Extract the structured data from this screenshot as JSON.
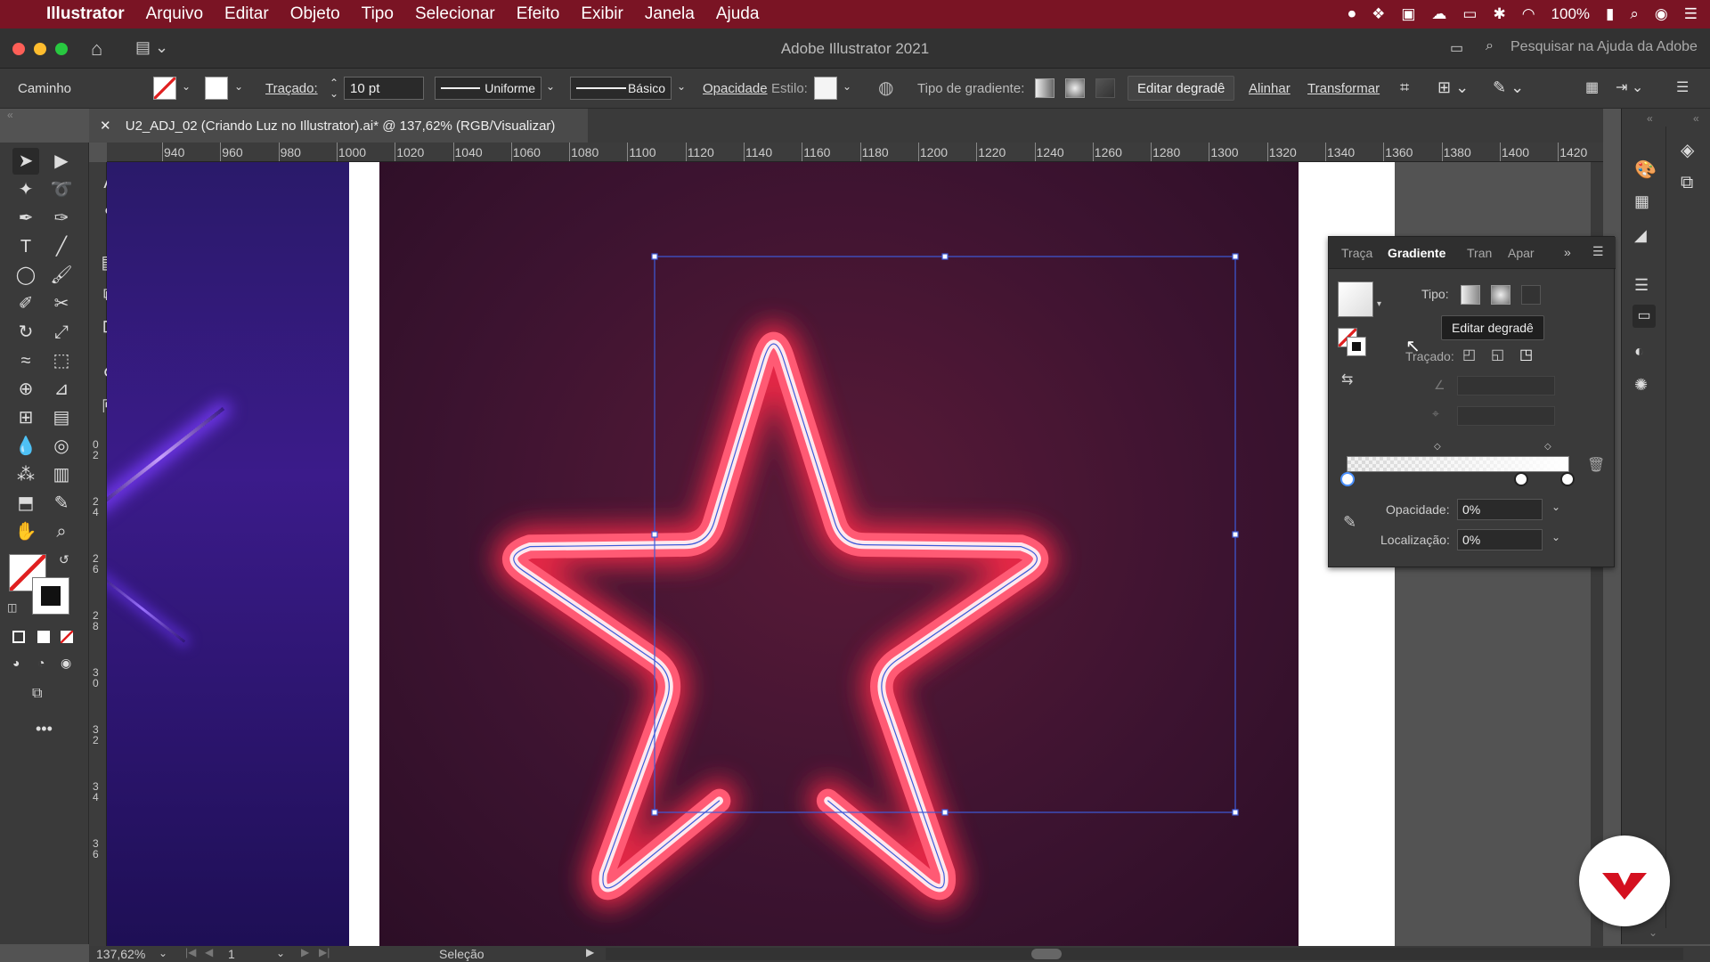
{
  "menubar": {
    "apple_icon": "apple-icon",
    "app_name": "Illustrator",
    "items": [
      "Arquivo",
      "Editar",
      "Objeto",
      "Tipo",
      "Selecionar",
      "Efeito",
      "Exibir",
      "Janela",
      "Ajuda"
    ],
    "battery": "100%"
  },
  "titlebar": {
    "title": "Adobe Illustrator 2021",
    "help_search_placeholder": "Pesquisar na Ajuda da Adobe"
  },
  "controlbar": {
    "object_type": "Caminho",
    "stroke_label": "Traçado:",
    "stroke_weight": "10 pt",
    "stroke_profile": "Uniforme",
    "brush": "Básico",
    "opacity_label": "Opacidade",
    "style_label": "Estilo:",
    "gradient_type_label": "Tipo de gradiente:",
    "edit_gradient_button": "Editar degradê",
    "align_link": "Alinhar",
    "transform_link": "Transformar"
  },
  "document_tab": {
    "title": "U2_ADJ_02 (Criando Luz no Illustrator).ai* @ 137,62% (RGB/Visualizar)"
  },
  "ruler_top": [
    "940",
    "960",
    "980",
    "1000",
    "1020",
    "1040",
    "1060",
    "1080",
    "1100",
    "1120",
    "1140",
    "1160",
    "1180",
    "1200",
    "1220",
    "1240",
    "1260",
    "1280",
    "1300",
    "1320",
    "1340",
    "1360",
    "1380",
    "1400",
    "1420"
  ],
  "ruler_left": [
    "0",
    "2",
    "2",
    "4",
    "2",
    "6",
    "2",
    "8",
    "3",
    "0",
    "3",
    "2",
    "3",
    "4",
    "3",
    "6"
  ],
  "gradient_panel": {
    "tabs": [
      "Traça",
      "Gradiente",
      "Tran",
      "Apar"
    ],
    "active_tab": "Gradiente",
    "type_label": "Tipo:",
    "tooltip": "Editar degradê",
    "stroke_label": "Traçado:",
    "opacity_label": "Opacidade:",
    "opacity_value": "0%",
    "location_label": "Localização:",
    "location_value": "0%"
  },
  "statusbar": {
    "zoom": "137,62%",
    "artboard_number": "1",
    "tool_name": "Seleção"
  },
  "colors": {
    "menubar_bg": "#7a1424",
    "neon_outer": "#ff3b55",
    "neon_core": "#ffffff",
    "selection": "#3d5bd9"
  }
}
